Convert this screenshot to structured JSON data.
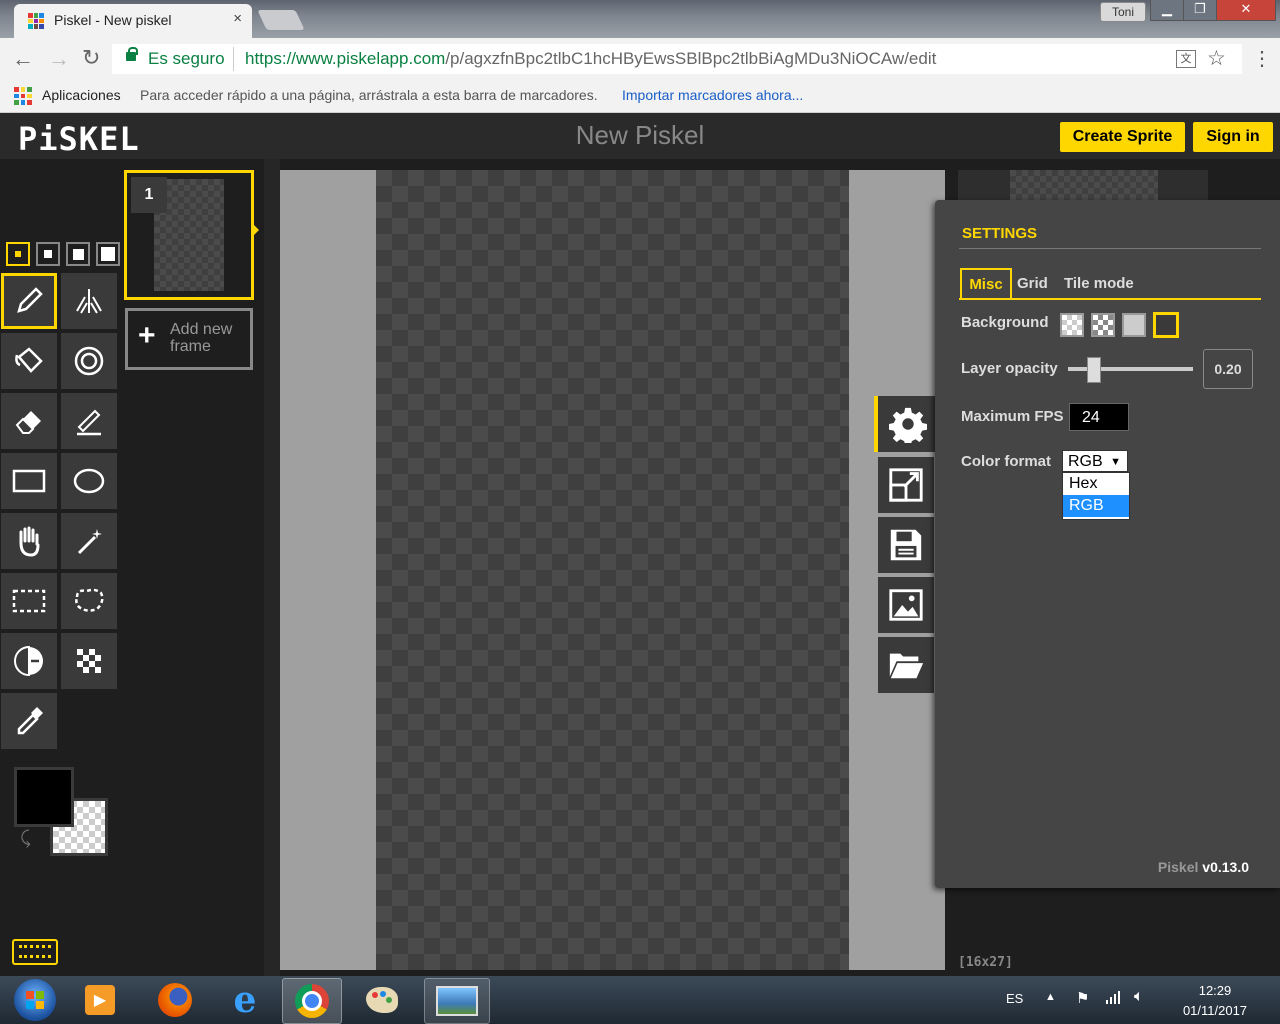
{
  "browser": {
    "tab_title": "Piskel - New piskel",
    "tab_close": "×",
    "user_name": "Toni",
    "secure_label": "Es seguro",
    "url_host": "https://www.piskelapp.com",
    "url_path": "/p/agxzfnBpc2tlbC1hcHByEwsSBlBpc2tlbBiAgMDu3NiOCAw/edit",
    "bookmarks": {
      "apps_label": "Aplicaciones",
      "hint": "Para acceder rápido a una página, arrástrala a esta barra de marcadores.",
      "import_link": "Importar marcadores ahora..."
    }
  },
  "app": {
    "logo": "PiSKEL",
    "title": "New Piskel",
    "create_sprite": "Create Sprite",
    "sign_in": "Sign in"
  },
  "frames": {
    "first_frame_number": "1",
    "add_new_frame": "Add new frame"
  },
  "settings": {
    "heading": "SETTINGS",
    "tabs": [
      "Misc",
      "Grid",
      "Tile mode"
    ],
    "active_tab": "Misc",
    "background_label": "Background",
    "layer_opacity_label": "Layer opacity",
    "layer_opacity_value": "0.20",
    "layer_opacity_fraction": 0.2,
    "max_fps_label": "Maximum FPS",
    "max_fps_value": "24",
    "color_format_label": "Color format",
    "color_format_selected": "RGB",
    "color_format_options": [
      "Hex",
      "RGB"
    ],
    "version_prefix": "Piskel",
    "version": "v0.13.0"
  },
  "canvas": {
    "size_label": "[16x27]"
  },
  "taskbar": {
    "lang": "ES",
    "time": "12:29",
    "date": "01/11/2017"
  },
  "colors": {
    "accent": "#ffd700",
    "primary_color": "#000000"
  }
}
